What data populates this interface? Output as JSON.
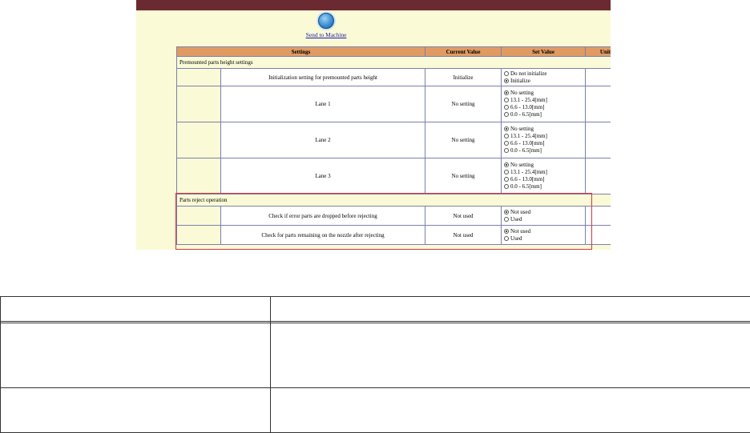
{
  "toolbar": {
    "send_label": "Send to Machine"
  },
  "table": {
    "headers": {
      "settings": "Settings",
      "current_value": "Current Value",
      "set_value": "Set Value",
      "unit": "Unit"
    },
    "sections": [
      {
        "title": "Premounted parts height settings",
        "rows": [
          {
            "name": "Initialization setting for premounted parts height",
            "current": "Initialize",
            "options": [
              "Do not initialize",
              "Initialize"
            ],
            "selected": 1
          },
          {
            "name": "Lane 1",
            "current": "No setting",
            "options": [
              "No setting",
              "13.1 - 25.4[mm]",
              "6.6 - 13.0[mm]",
              "0.0 - 6.5[mm]"
            ],
            "selected": 0
          },
          {
            "name": "Lane 2",
            "current": "No setting",
            "options": [
              "No setting",
              "13.1 - 25.4[mm]",
              "6.6 - 13.0[mm]",
              "0.0 - 6.5[mm]"
            ],
            "selected": 0
          },
          {
            "name": "Lane 3",
            "current": "No setting",
            "options": [
              "No setting",
              "13.1 - 25.4[mm]",
              "6.6 - 13.0[mm]",
              "0.0 - 6.5[mm]"
            ],
            "selected": 0
          }
        ]
      },
      {
        "title": "Parts reject operation",
        "rows": [
          {
            "name": "Check if error parts are dropped before rejecting",
            "current": "Not used",
            "options": [
              "Not used",
              "Used"
            ],
            "selected": 0
          },
          {
            "name": "Check for parts remaining on the nozzle after rejecting",
            "current": "Not used",
            "options": [
              "Not used",
              "Used"
            ],
            "selected": 0
          }
        ]
      }
    ]
  },
  "colors": {
    "topbar": "#6b2a31",
    "page_bg": "#fafad6",
    "header_bg": "#e09b63",
    "highlight": "#d9363e",
    "link": "#1a1aa8"
  },
  "icons": {
    "send": "send-to-machine-icon"
  }
}
